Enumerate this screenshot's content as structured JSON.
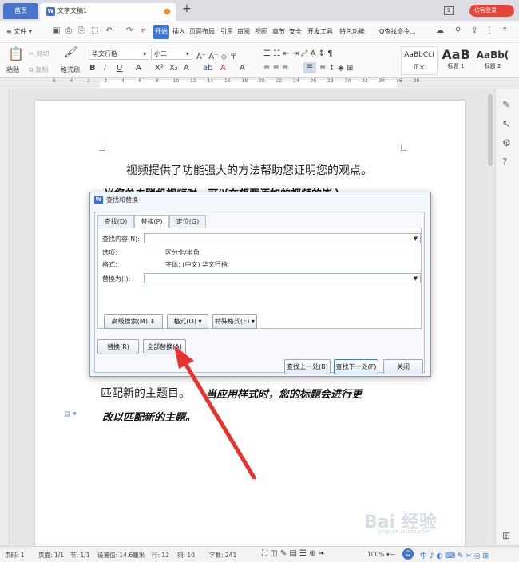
{
  "tabs": {
    "home": "首页",
    "doc": "文字文稿1",
    "add": "+",
    "badge": "1",
    "visitor": "访客登录"
  },
  "menu": {
    "file": "≡ 文件 ▾",
    "items": [
      "开始",
      "插入",
      "页面布局",
      "引用",
      "审阅",
      "视图",
      "章节",
      "安全",
      "开发工具",
      "特色功能"
    ],
    "search": "Q查找命令..."
  },
  "ribbon": {
    "paste": "粘贴",
    "cut": "剪切",
    "copy": "复制",
    "format_painter": "格式刷",
    "font": "华文行楷",
    "size": "小二",
    "styles": [
      {
        "preview": "AaBbCcI",
        "name": "正文"
      },
      {
        "preview": "AaB",
        "name": "标题 1"
      },
      {
        "preview": "AaBb(",
        "name": "标题 2"
      }
    ]
  },
  "ruler": {
    "ticks": [
      "6",
      "4",
      "2",
      "2",
      "4",
      "6",
      "8",
      "10",
      "12",
      "14",
      "16",
      "18",
      "20",
      "22",
      "24",
      "26",
      "28",
      "30",
      "32",
      "34",
      "36",
      "38"
    ]
  },
  "document": {
    "line1": "视频提供了功能强大的方法帮助您证明您的观点。",
    "line2": "当您单击联机视频时，可以在想要添加的视频的嵌入",
    "line3a": "匹配新的主题目。",
    "line3b": "当应用样式时，您的标题会进行更",
    "line4": "改以匹配新的主题。"
  },
  "dialog": {
    "title": "查找和替换",
    "tabs": [
      "查找(D)",
      "替换(P)",
      "定位(G)"
    ],
    "find_label": "查找内容(N):",
    "find_value": "",
    "options_label": "选项:",
    "options_value": "区分全/半角",
    "format_label": "格式:",
    "format_value": "字体: (中文) 华文行楷",
    "replace_label": "替换为(I):",
    "replace_value": "",
    "adv_search": "高级搜索(M) ⇟",
    "format_btn": "格式(O) ▾",
    "special_btn": "特殊格式(E) ▾",
    "replace_btn": "替换(R)",
    "replace_all_btn": "全部替换(A)",
    "find_prev_btn": "查找上一处(B)",
    "find_next_btn": "查找下一处(F)",
    "close_btn": "关闭"
  },
  "statusbar": {
    "page": "页码: 1",
    "pages": "页面: 1/1",
    "section": "节: 1/1",
    "setting": "设置值: 14.6厘米",
    "row": "行: 12",
    "col": "列: 10",
    "words": "字数: 241",
    "zoom": "100% ▾",
    "minus": "—"
  },
  "watermark": "Bai 经验",
  "watermark_url": "jingyan.baidu.com",
  "colors": {
    "accent": "#3d75d9",
    "arrow": "#e8322e",
    "visitor": "#e4463a"
  }
}
